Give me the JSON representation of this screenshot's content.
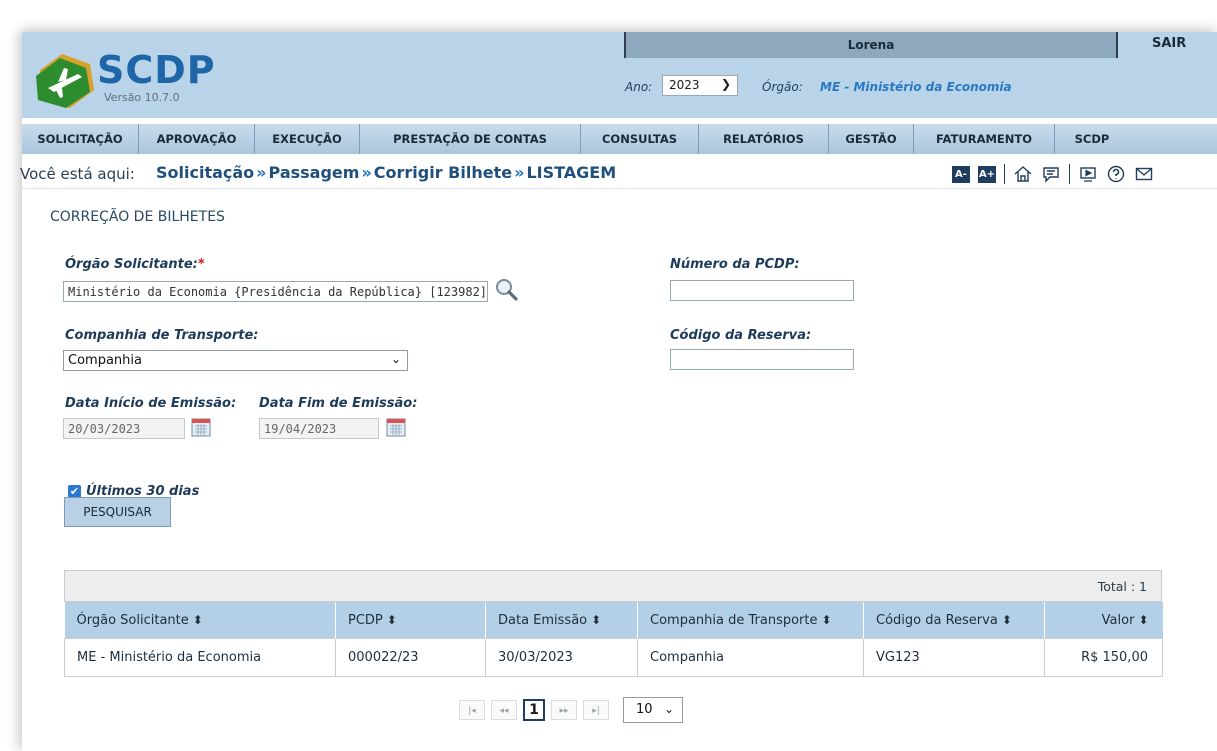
{
  "app": {
    "logo_text": "SCDP",
    "version": "Versão 10.7.0"
  },
  "userbar": {
    "username": "Lorena",
    "logout_label": "SAIR"
  },
  "header": {
    "year_label": "Ano:",
    "year_value": "2023",
    "org_label": "Órgão:",
    "org_value": "ME - Ministério da Economia"
  },
  "nav": {
    "items": [
      {
        "label": "SOLICITAÇÃO"
      },
      {
        "label": "APROVAÇÃO"
      },
      {
        "label": "EXECUÇÃO"
      },
      {
        "label": "PRESTAÇÃO DE CONTAS"
      },
      {
        "label": "CONSULTAS"
      },
      {
        "label": "RELATÓRIOS"
      },
      {
        "label": "GESTÃO"
      },
      {
        "label": "FATURAMENTO"
      },
      {
        "label": "SCDP"
      }
    ]
  },
  "breadcrumb": {
    "prefix": "Você está aqui:",
    "items": [
      "Solicitação",
      "Passagem",
      "Corrigir Bilhete",
      "LISTAGEM"
    ]
  },
  "toolbar": {
    "font_decrease": "A-",
    "font_increase": "A+"
  },
  "page": {
    "title": "CORREÇÃO DE BILHETES"
  },
  "form": {
    "orgao_label": "Órgão Solicitante:",
    "orgao_required": "*",
    "orgao_value": "Ministério da Economia {Presidência da República} [123982]",
    "pcdp_label": "Número da PCDP:",
    "pcdp_value": "",
    "companhia_label": "Companhia de Transporte:",
    "companhia_value": "Companhia",
    "reserva_label": "Código da Reserva:",
    "reserva_value": "",
    "data_inicio_label": "Data Início de Emissão:",
    "data_inicio_value": "20/03/2023",
    "data_fim_label": "Data Fim de Emissão:",
    "data_fim_value": "19/04/2023",
    "ultimos_label": "Últimos 30 dias",
    "ultimos_checked": true,
    "search_button": "PESQUISAR"
  },
  "results": {
    "total_text": "Total : 1",
    "columns": [
      "Órgão Solicitante",
      "PCDP",
      "Data Emissão",
      "Companhia de Transporte",
      "Código da Reserva",
      "Valor"
    ],
    "rows": [
      [
        "ME - Ministério da Economia",
        "000022/23",
        "30/03/2023",
        "Companhia",
        "VG123",
        "R$ 150,00"
      ]
    ]
  },
  "pagination": {
    "current_page": "1",
    "page_size": "10"
  },
  "colors": {
    "header_bg": "#b9d3e8",
    "nav_bg": "#aac6de",
    "accent": "#1f3d5c",
    "link": "#2878c2",
    "required": "#d0191f"
  }
}
